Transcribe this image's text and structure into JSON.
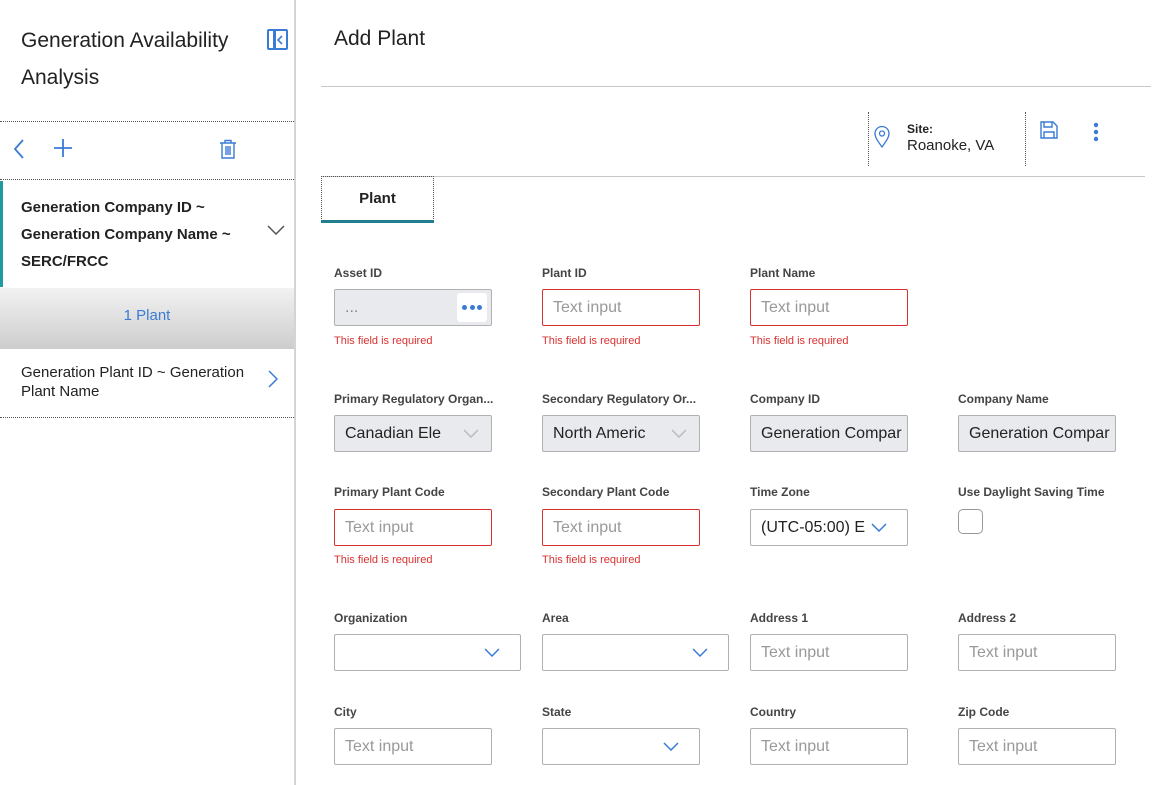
{
  "sidebar": {
    "title": "Generation Availability Analysis",
    "group": "Generation Company ID ~ Generation Company Name ~ SERC/FRCC",
    "count_label": "1 Plant",
    "plant_item": "Generation Plant ID ~ Generation Plant Name"
  },
  "main": {
    "title": "Add Plant",
    "site": {
      "label": "Site:",
      "value": "Roanoke, VA"
    },
    "tabs": [
      {
        "label": "Plant"
      }
    ]
  },
  "form": {
    "required_message": "This field is required",
    "placeholder": "Text input",
    "asset_id": {
      "label": "Asset ID",
      "value": "..."
    },
    "plant_id": {
      "label": "Plant ID"
    },
    "plant_name": {
      "label": "Plant Name"
    },
    "primary_reg_org": {
      "label": "Primary Regulatory Organ...",
      "value": "Canadian Ele"
    },
    "secondary_reg_org": {
      "label": "Secondary Regulatory Or...",
      "value": "North Americ"
    },
    "company_id": {
      "label": "Company ID",
      "value": "Generation Compar"
    },
    "company_name": {
      "label": "Company Name",
      "value": "Generation Compar"
    },
    "primary_plant_code": {
      "label": "Primary Plant Code"
    },
    "secondary_plant_code": {
      "label": "Secondary Plant Code"
    },
    "time_zone": {
      "label": "Time Zone",
      "value": "(UTC-05:00) E"
    },
    "daylight_saving": {
      "label": "Use Daylight Saving Time",
      "checked": false
    },
    "organization": {
      "label": "Organization",
      "value": ""
    },
    "area": {
      "label": "Area",
      "value": ""
    },
    "address1": {
      "label": "Address 1"
    },
    "address2": {
      "label": "Address 2"
    },
    "city": {
      "label": "City"
    },
    "state": {
      "label": "State",
      "value": ""
    },
    "country": {
      "label": "Country"
    },
    "zip": {
      "label": "Zip Code"
    }
  },
  "colors": {
    "accent": "#3a7bd5",
    "error": "#d93030",
    "teal": "#1f9aa0"
  },
  "icons": [
    "collapse-panel-icon",
    "back-icon",
    "add-icon",
    "trash-icon",
    "chevron-down-icon",
    "chevron-right-icon",
    "location-pin-icon",
    "save-icon",
    "more-vertical-icon",
    "ellipsis-icon"
  ]
}
